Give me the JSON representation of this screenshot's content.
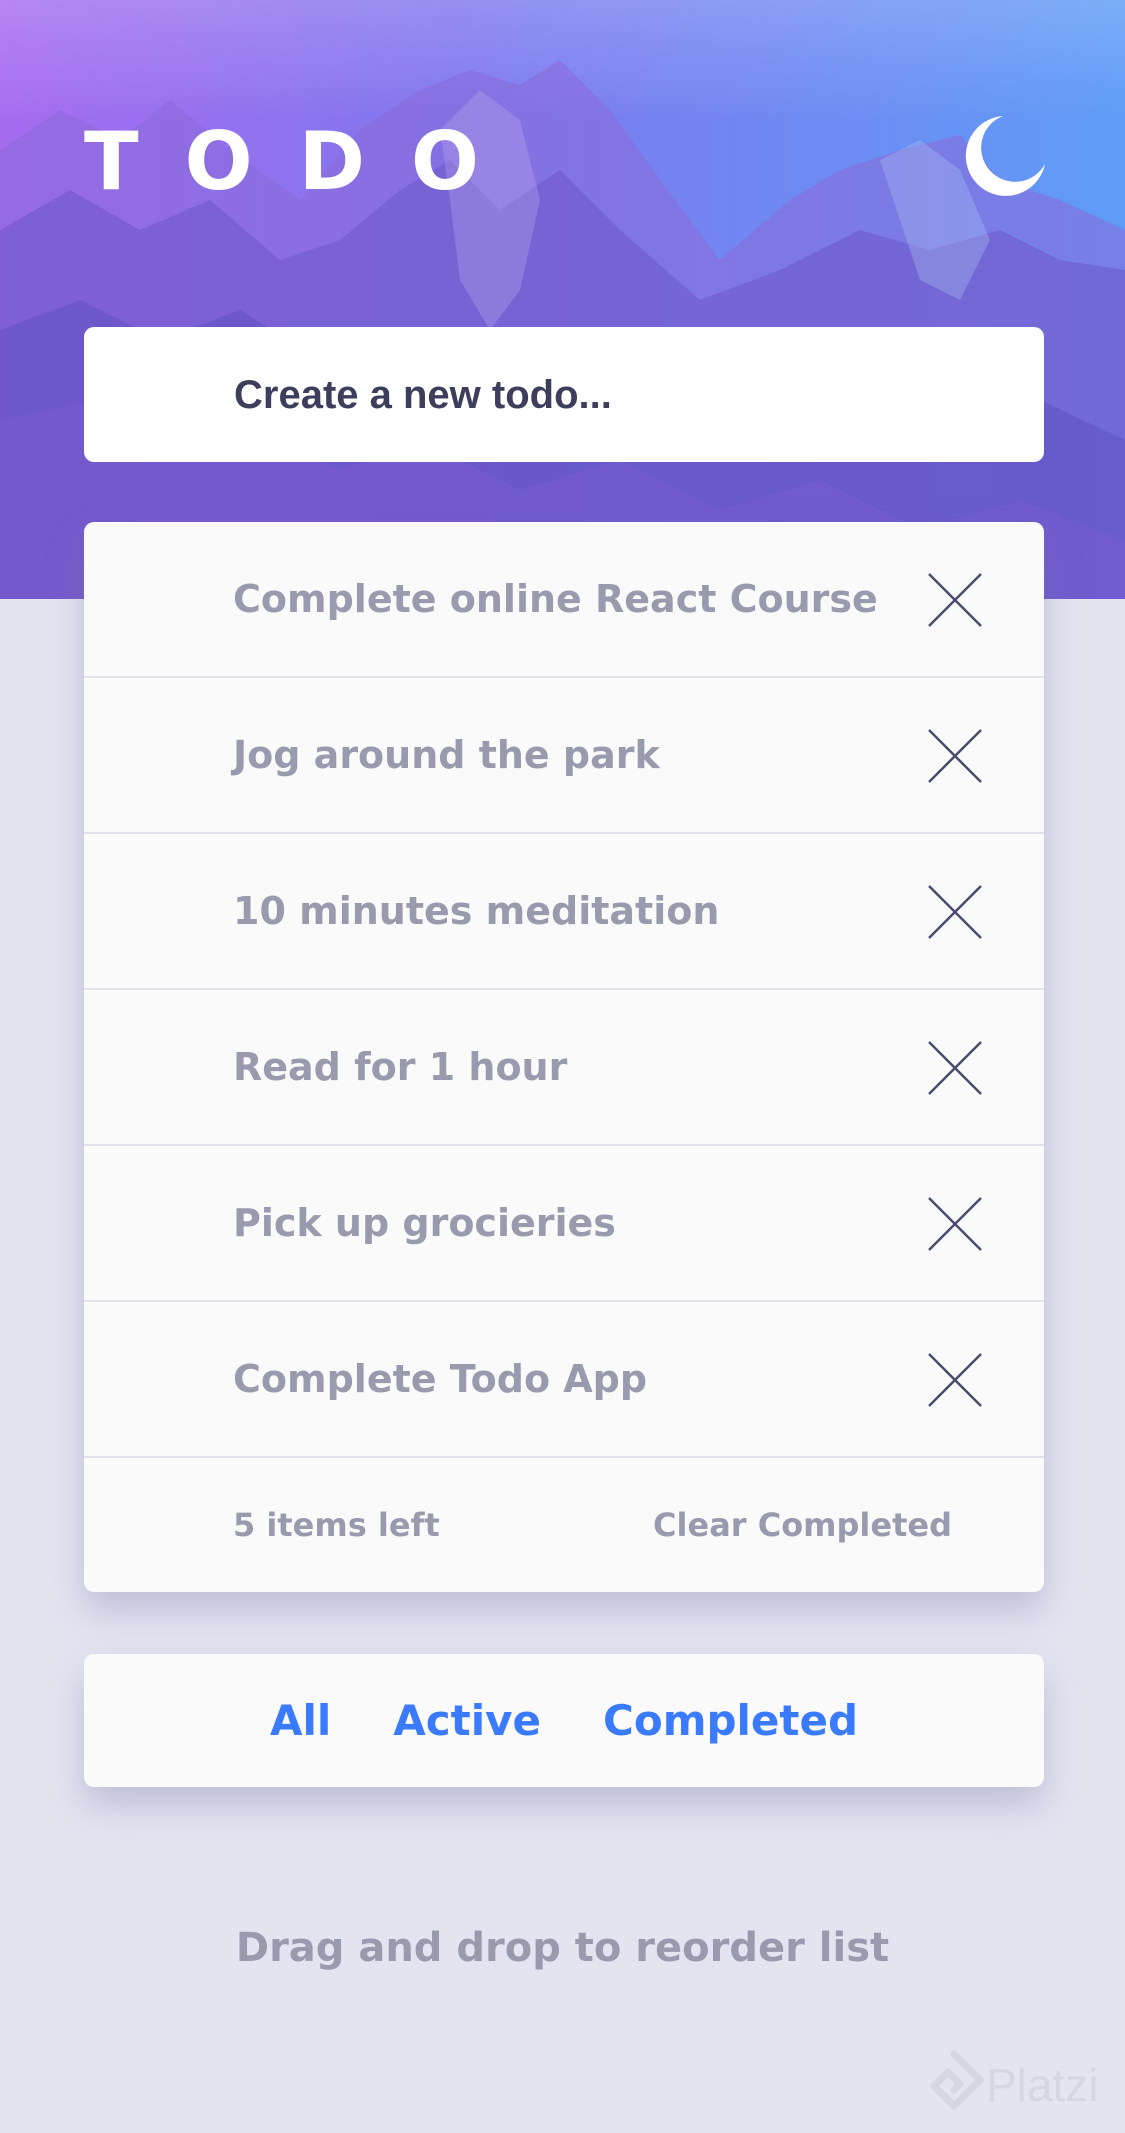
{
  "header": {
    "title": "TODO",
    "theme_toggle_icon": "moon-icon"
  },
  "new_todo": {
    "placeholder": "Create a new todo..."
  },
  "todos": [
    {
      "text": "Complete online React Course"
    },
    {
      "text": "Jog around the park"
    },
    {
      "text": "10 minutes meditation"
    },
    {
      "text": "Read for 1 hour"
    },
    {
      "text": "Pick up grocieries"
    },
    {
      "text": "Complete Todo App"
    }
  ],
  "delete_icon": "close-icon",
  "footer": {
    "items_left": "5 items left",
    "clear_label": "Clear Completed"
  },
  "filters": {
    "all": "All",
    "active": "Active",
    "completed": "Completed"
  },
  "hint": "Drag and drop to reorder list",
  "watermark": {
    "text": "Platzi"
  },
  "colors": {
    "accent_blue": "#3a7bfd",
    "text_muted": "#9a9aae",
    "background": "#e4e4f1",
    "card": "#fafafa",
    "gradient_start": "#a76cf0",
    "gradient_end": "#5d9cf7"
  }
}
